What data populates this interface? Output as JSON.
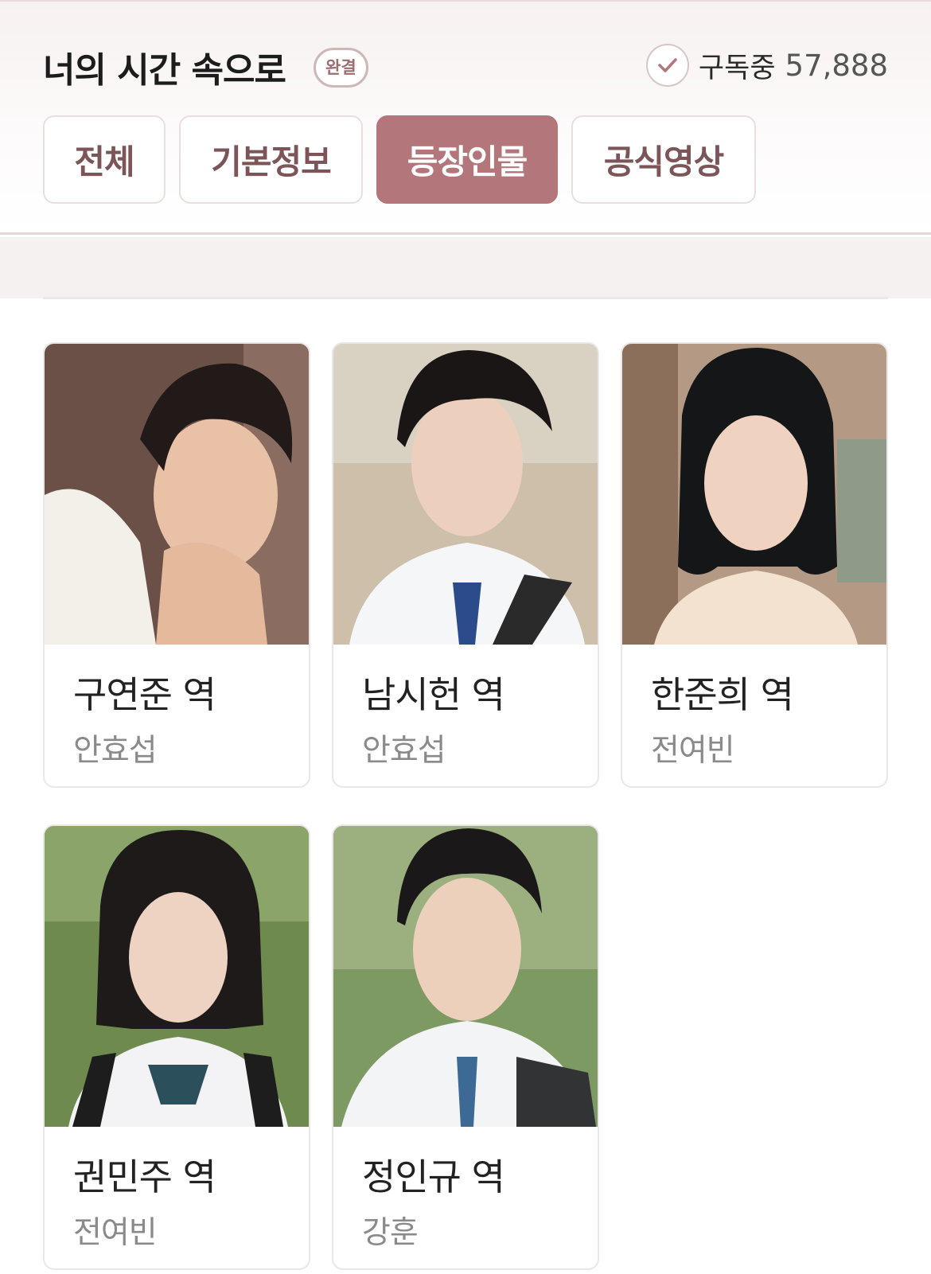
{
  "header": {
    "title": "너의 시간 속으로",
    "status_badge": "완결",
    "subscribe_label": "구독중",
    "subscribe_count": "57,888"
  },
  "tabs": [
    {
      "label": "전체",
      "active": false
    },
    {
      "label": "기본정보",
      "active": false
    },
    {
      "label": "등장인물",
      "active": true
    },
    {
      "label": "공식영상",
      "active": false
    }
  ],
  "colors": {
    "accent": "#b3777b",
    "tab_text": "#7b5557",
    "badge_border": "#cdb7b7",
    "actor_text": "#8a8a8a"
  },
  "characters": [
    {
      "role": "구연준 역",
      "actor": "안효섭"
    },
    {
      "role": "남시헌 역",
      "actor": "안효섭"
    },
    {
      "role": "한준희 역",
      "actor": "전여빈"
    },
    {
      "role": "권민주 역",
      "actor": "전여빈"
    },
    {
      "role": "정인규 역",
      "actor": "강훈"
    }
  ]
}
